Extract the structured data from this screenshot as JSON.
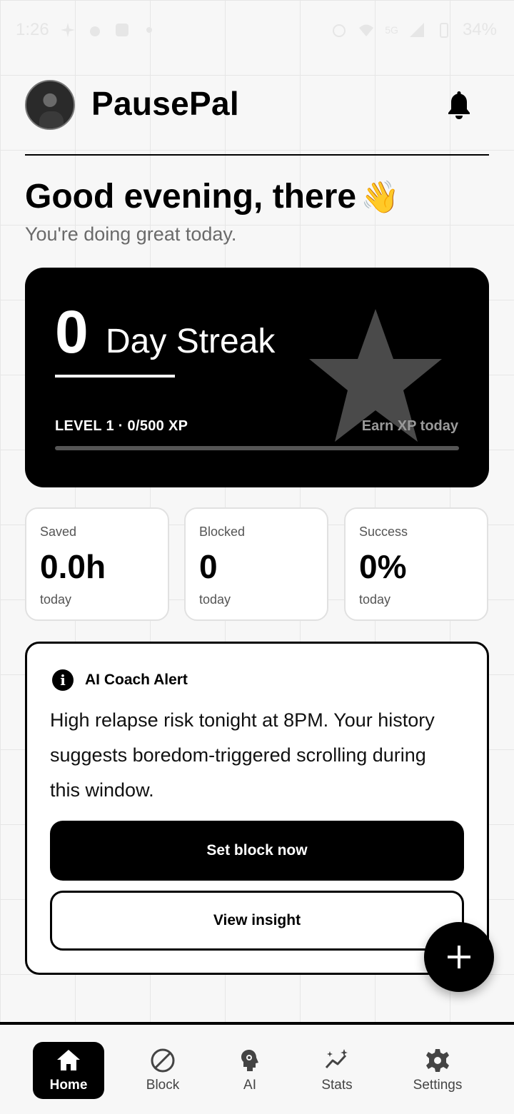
{
  "status_bar": {
    "time": "1:26",
    "battery": "34%",
    "network": "5G"
  },
  "header": {
    "app_title": "PausePal",
    "avatar_icon": "avatar",
    "bell_icon": "bell-icon"
  },
  "greeting": {
    "title": "Good evening, there",
    "emoji": "👋",
    "subtitle": "You're doing great today."
  },
  "streak": {
    "days": "0",
    "label": "Day Streak",
    "level_text": "LEVEL 1 · 0/500 XP",
    "earn_text": "Earn XP today",
    "xp_progress": 0
  },
  "stats": [
    {
      "label": "Saved",
      "value": "0.0h",
      "period": "today"
    },
    {
      "label": "Blocked",
      "value": "0",
      "period": "today"
    },
    {
      "label": "Success",
      "value": "0%",
      "period": "today"
    }
  ],
  "coach": {
    "title": "AI Coach Alert",
    "message": "High relapse risk tonight at 8PM. Your history suggests boredom-triggered scrolling during this window.",
    "primary_button": "Set block now",
    "secondary_button": "View insight"
  },
  "nav": {
    "items": [
      {
        "label": "Home",
        "icon": "home-icon",
        "active": true
      },
      {
        "label": "Block",
        "icon": "block-icon",
        "active": false
      },
      {
        "label": "AI",
        "icon": "ai-brain-icon",
        "active": false
      },
      {
        "label": "Stats",
        "icon": "stats-icon",
        "active": false
      },
      {
        "label": "Settings",
        "icon": "gear-icon",
        "active": false
      }
    ]
  },
  "colors": {
    "accent": "#000000",
    "background": "#f7f7f7",
    "muted": "#6a6a6a"
  }
}
